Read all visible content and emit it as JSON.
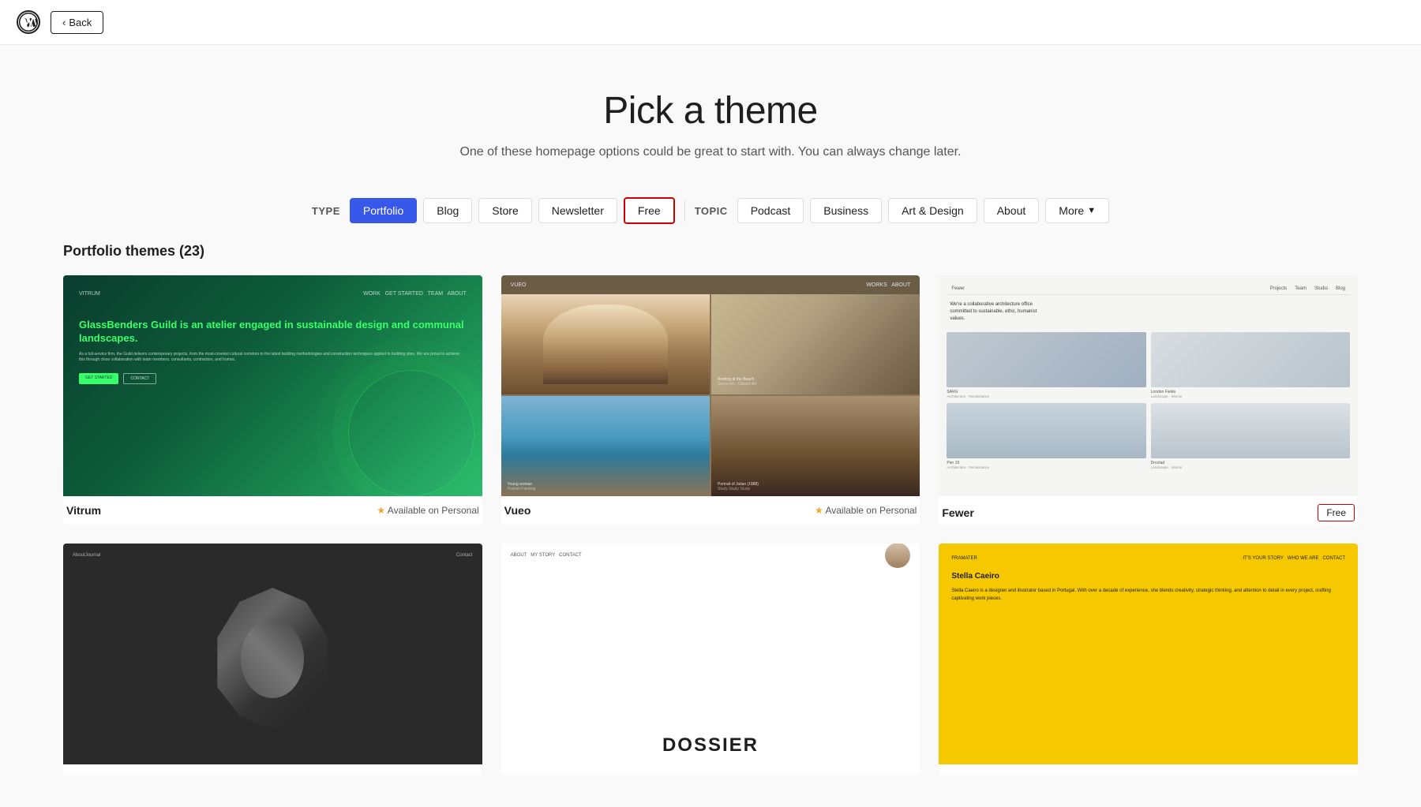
{
  "app": {
    "logo_alt": "WordPress",
    "back_label": "Back"
  },
  "hero": {
    "title": "Pick a theme",
    "subtitle": "One of these homepage options could be great to start with. You can always change later."
  },
  "filters": {
    "type_label": "TYPE",
    "topic_label": "TOPIC",
    "buttons_type": [
      {
        "id": "portfolio",
        "label": "Portfolio",
        "active": true
      },
      {
        "id": "blog",
        "label": "Blog",
        "active": false
      },
      {
        "id": "store",
        "label": "Store",
        "active": false
      },
      {
        "id": "newsletter",
        "label": "Newsletter",
        "active": false
      },
      {
        "id": "free",
        "label": "Free",
        "active": false,
        "outlined": true
      }
    ],
    "buttons_topic": [
      {
        "id": "podcast",
        "label": "Podcast",
        "active": false
      },
      {
        "id": "business",
        "label": "Business",
        "active": false
      },
      {
        "id": "art-design",
        "label": "Art & Design",
        "active": false
      },
      {
        "id": "about",
        "label": "About",
        "active": false
      },
      {
        "id": "more",
        "label": "More",
        "active": false,
        "has_chevron": true
      }
    ]
  },
  "section": {
    "title": "Portfolio themes (23)"
  },
  "themes": [
    {
      "id": "vitrum",
      "name": "Vitrum",
      "badge_type": "star",
      "badge_text": "Available on Personal",
      "preview_type": "vitrum"
    },
    {
      "id": "vueo",
      "name": "Vueo",
      "badge_type": "star",
      "badge_text": "Available on Personal",
      "preview_type": "vueo"
    },
    {
      "id": "fewer",
      "name": "Fewer",
      "badge_type": "free",
      "badge_text": "Free",
      "preview_type": "fewer"
    },
    {
      "id": "dark-spiral",
      "name": "",
      "badge_type": "none",
      "badge_text": "",
      "preview_type": "dark"
    },
    {
      "id": "dossier",
      "name": "",
      "badge_type": "none",
      "badge_text": "",
      "preview_type": "dossier"
    },
    {
      "id": "yellow-designer",
      "name": "",
      "badge_type": "none",
      "badge_text": "",
      "preview_type": "yellow"
    }
  ]
}
